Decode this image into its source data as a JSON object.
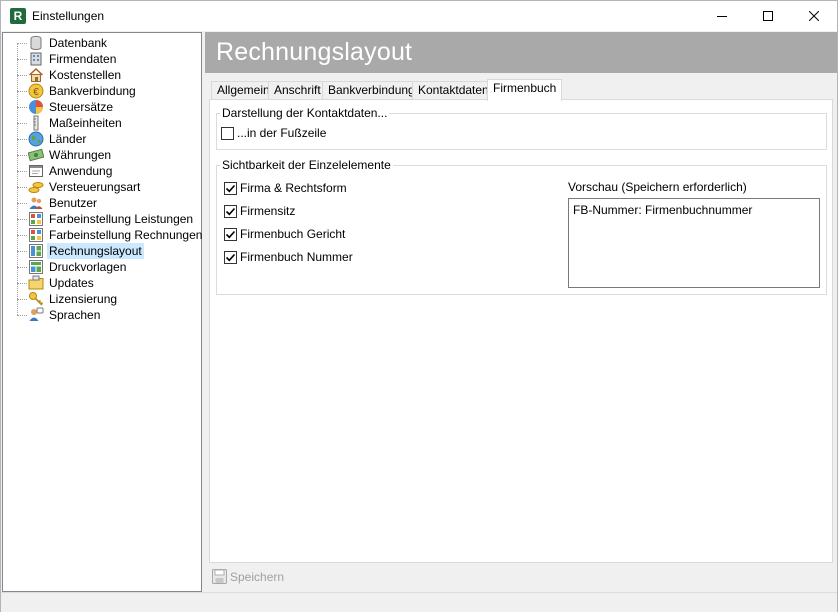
{
  "window": {
    "title": "Einstellungen",
    "app_icon_letter": "R"
  },
  "sidebar": {
    "items": [
      {
        "label": "Datenbank",
        "icon": "database-icon",
        "selected": false
      },
      {
        "label": "Firmendaten",
        "icon": "building-icon",
        "selected": false
      },
      {
        "label": "Kostenstellen",
        "icon": "house-icon",
        "selected": false
      },
      {
        "label": "Bankverbindung",
        "icon": "euro-icon",
        "selected": false
      },
      {
        "label": "Steuersätze",
        "icon": "pie-chart-icon",
        "selected": false
      },
      {
        "label": "Maßeinheiten",
        "icon": "ruler-icon",
        "selected": false
      },
      {
        "label": "Länder",
        "icon": "globe-icon",
        "selected": false
      },
      {
        "label": "Währungen",
        "icon": "money-icon",
        "selected": false
      },
      {
        "label": "Anwendung",
        "icon": "window-icon",
        "selected": false
      },
      {
        "label": "Versteuerungsart",
        "icon": "coins-icon",
        "selected": false
      },
      {
        "label": "Benutzer",
        "icon": "users-icon",
        "selected": false
      },
      {
        "label": "Farbeinstellung Leistungen",
        "icon": "color-grid-icon",
        "selected": false
      },
      {
        "label": "Farbeinstellung Rechnungen",
        "icon": "color-grid-icon",
        "selected": false
      },
      {
        "label": "Rechnungslayout",
        "icon": "layout-icon",
        "selected": true
      },
      {
        "label": "Druckvorlagen",
        "icon": "template-icon",
        "selected": false
      },
      {
        "label": "Updates",
        "icon": "update-folder-icon",
        "selected": false
      },
      {
        "label": "Lizensierung",
        "icon": "key-icon",
        "selected": false
      },
      {
        "label": "Sprachen",
        "icon": "language-icon",
        "selected": false
      }
    ]
  },
  "header": {
    "title": "Rechnungslayout"
  },
  "tabs": [
    {
      "label": "Allgemein",
      "active": false
    },
    {
      "label": "Anschrift",
      "active": false
    },
    {
      "label": "Bankverbindung",
      "active": false
    },
    {
      "label": "Kontaktdaten",
      "active": false
    },
    {
      "label": "Firmenbuch",
      "active": true
    }
  ],
  "contact_group": {
    "legend": "Darstellung der Kontaktdaten...",
    "footer_checkbox": {
      "label": "...in der Fußzeile",
      "checked": false
    }
  },
  "visibility_group": {
    "legend": "Sichtbarkeit der Einzelelemente",
    "checkboxes": [
      {
        "label": "Firma & Rechtsform",
        "checked": true
      },
      {
        "label": "Firmensitz",
        "checked": true
      },
      {
        "label": "Firmenbuch Gericht",
        "checked": true
      },
      {
        "label": "Firmenbuch Nummer",
        "checked": true
      }
    ],
    "preview_label": "Vorschau (Speichern erforderlich)",
    "preview_text": "FB-Nummer: Firmenbuchnummer"
  },
  "footer": {
    "save_label": "Speichern",
    "save_enabled": false
  },
  "colors": {
    "header_band": "#a9a9a9",
    "selected_item": "#cce8ff",
    "disabled_text": "#a0a0a0"
  }
}
